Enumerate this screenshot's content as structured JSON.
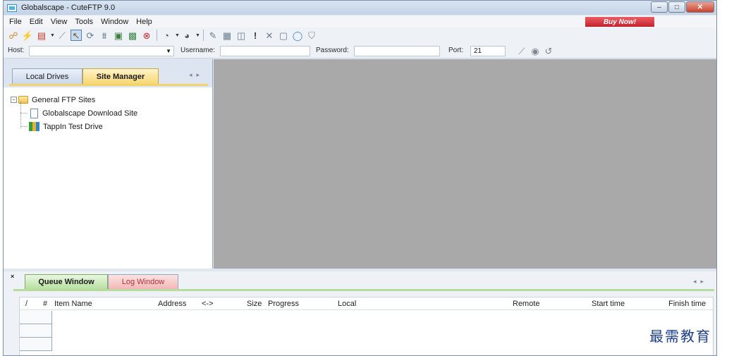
{
  "window": {
    "title": "Globalscape - CuteFTP 9.0"
  },
  "caption": {
    "minimize": "–",
    "maximize": "□",
    "close": "✕"
  },
  "menu": {
    "items": [
      "File",
      "Edit",
      "View",
      "Tools",
      "Window",
      "Help"
    ],
    "buy_now": "Buy Now!"
  },
  "connection": {
    "host_label": "Host:",
    "host_value": "",
    "username_label": "Username:",
    "username_value": "",
    "password_label": "Password:",
    "password_value": "",
    "port_label": "Port:",
    "port_value": "21"
  },
  "left_panel": {
    "tabs": [
      "Local Drives",
      "Site Manager"
    ],
    "active_tab": "Site Manager",
    "tree": {
      "root": "General FTP Sites",
      "children": [
        "Globalscape Download Site",
        "TappIn Test Drive"
      ]
    }
  },
  "queue_panel": {
    "pin": "×",
    "tabs": [
      "Queue Window",
      "Log Window"
    ],
    "active_tab": "Queue Window",
    "columns": [
      "/",
      "#",
      "Item Name",
      "Address",
      "<->",
      "Size",
      "Progress",
      "Local",
      "Remote",
      "Start time",
      "Finish time"
    ]
  },
  "watermark": "最需教育",
  "colors": {
    "site_tab": "#f7d774",
    "queue_tab": "#b7e09f",
    "log_tab": "#f3b7b7",
    "buy_now": "#c3222c",
    "mdi_background": "#a9a9a9"
  },
  "toolbar_icons": [
    "connect-icon",
    "quick-connect-icon",
    "new-site-icon",
    "disconnect-icon",
    "select-icon",
    "refresh-icon",
    "filter-icon",
    "site-properties-icon",
    "stop-icon",
    "back-icon",
    "forward-icon",
    "edit-icon",
    "log-icon",
    "open-icon",
    "alert-icon",
    "delete-icon",
    "new-file-icon",
    "reconnect-icon",
    "shield-icon"
  ]
}
